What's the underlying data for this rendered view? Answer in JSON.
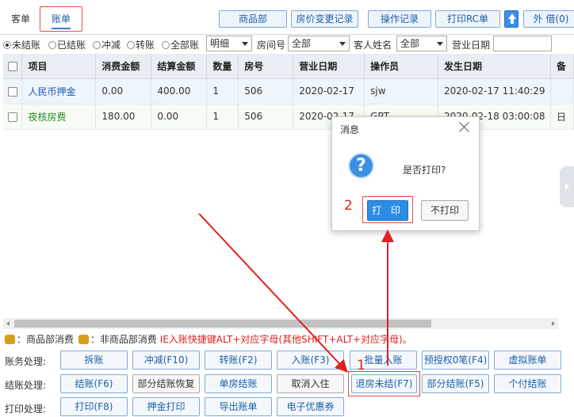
{
  "tabs": {
    "guest": "客单",
    "bill": "账单"
  },
  "toolbar": {
    "product": "商品部",
    "price_log": "房价变更记录",
    "op_log": "操作记录",
    "print_rc": "打印RC单",
    "borrow": "外 借(0)"
  },
  "filters": {
    "radios": [
      "未结账",
      "已结账",
      "冲减",
      "转账",
      "全部账"
    ],
    "detail_value": "明细",
    "room_label": "房间号",
    "room_value": "全部",
    "guest_label": "客人姓名",
    "guest_value": "全部",
    "bizdate_label": "营业日期"
  },
  "table": {
    "headers": [
      "项目",
      "消费金额",
      "结算金额",
      "数量",
      "房号",
      "营业日期",
      "操作员",
      "发生日期",
      "备"
    ],
    "rows": [
      {
        "item": "人民币押金",
        "consume": "0.00",
        "settle": "400.00",
        "qty": "1",
        "room": "506",
        "bizdate": "2020-02-17",
        "operator": "sjw",
        "occurred": "2020-02-17 11:40:29",
        "extra": ""
      },
      {
        "item": "夜核房费",
        "consume": "180.00",
        "settle": "0.00",
        "qty": "1",
        "room": "506",
        "bizdate": "2020-02-17",
        "operator": "GPT",
        "occurred": "2020-02-18 03:00:08",
        "extra": "日"
      }
    ]
  },
  "legend": {
    "text1": "：商品部消费",
    "text2": "：非商品部消费",
    "note": "IE入账快捷键ALT+对应字母(其他SHIFT+ALT+对应字母)。"
  },
  "rows": {
    "account_label": "账务处理:",
    "settle_label": "结账处理:",
    "print_label": "打印处理:",
    "account": [
      "拆账",
      "冲减(F10)",
      "转账(F2)",
      "入账(F3)",
      "批量入账",
      "预授权0笔(F4)",
      "虚拟账单"
    ],
    "settle": [
      "结账(F6)",
      "部分结账恢复",
      "单房结账",
      "取消入住",
      "退房未结(F7)",
      "部分结账(F5)",
      "个付结账"
    ],
    "print": [
      "打印(F8)",
      "押金打印",
      "导出账单",
      "电子优惠券"
    ]
  },
  "dialog": {
    "title": "消息",
    "message": "是否打印?",
    "icon": "?",
    "ok": "打 印",
    "cancel": "不打印"
  },
  "annotations": {
    "step1": "1",
    "step2": "2",
    "color": "#e02020"
  }
}
